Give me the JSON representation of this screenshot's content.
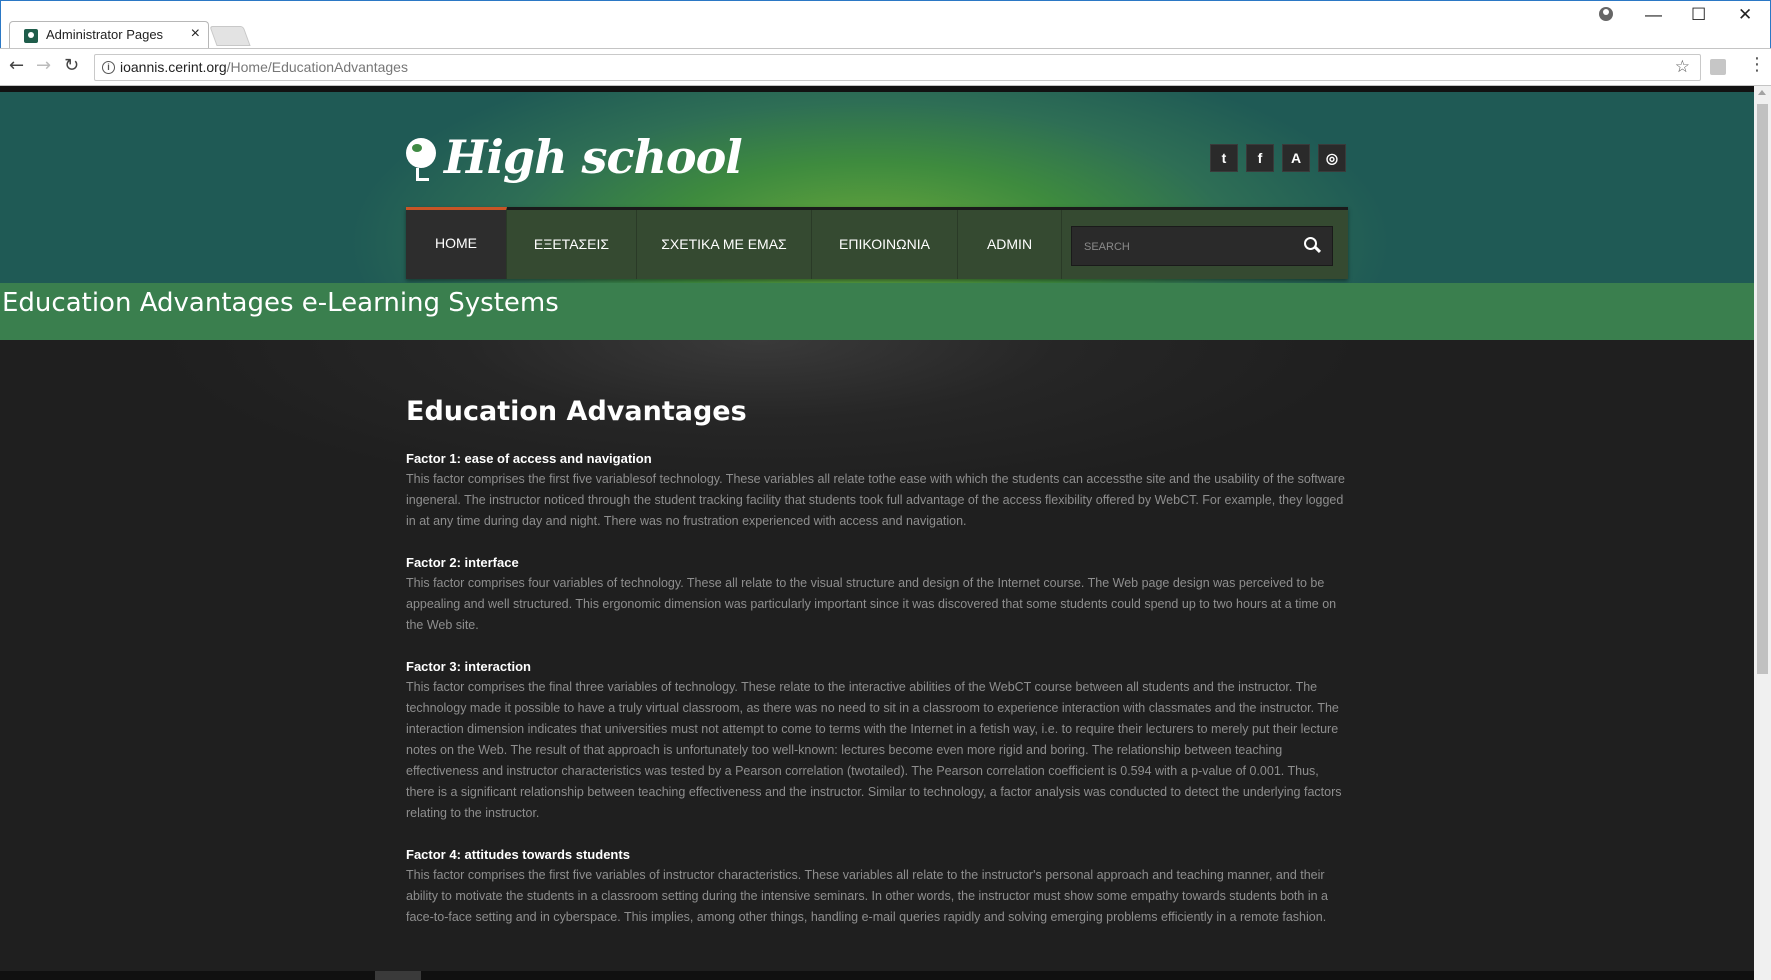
{
  "browser": {
    "tab_title": "Administrator Pages",
    "tab_close": "×",
    "url_host": "ioannis.cerint.org",
    "url_path": "/Home/EducationAdvantages",
    "back": "←",
    "forward": "→",
    "reload": "↻",
    "star": "☆",
    "menu": "⋮",
    "minimize": "—",
    "maximize": "☐",
    "close": "✕"
  },
  "site": {
    "logo_text": "High school",
    "social": [
      {
        "icon": "twitter-icon",
        "glyph": "t"
      },
      {
        "icon": "facebook-icon",
        "glyph": "f"
      },
      {
        "icon": "aim-icon",
        "glyph": "A"
      },
      {
        "icon": "dribbble-icon",
        "glyph": "◎"
      }
    ],
    "nav": [
      {
        "label": "HOME",
        "active": true
      },
      {
        "label": "ΕΞΕΤΑΣΕΙΣ",
        "active": false
      },
      {
        "label": "ΣΧΕΤΙΚΑ ΜΕ ΕΜΑΣ",
        "active": false
      },
      {
        "label": "ΕΠΙΚΟΙΝΩΝΙΑ",
        "active": false
      },
      {
        "label": "ADMIN",
        "active": false
      }
    ],
    "search_placeholder": "SEARCH",
    "colors": {
      "accent": "#c85526",
      "band": "#3a7f4e",
      "nav": "#354a31"
    }
  },
  "page": {
    "band_title": "Education Advantages e-Learning Systems",
    "heading": "Education Advantages",
    "factors": [
      {
        "title": "Factor 1: ease of access and navigation",
        "body": "This factor comprises the first five variablesof technology. These variables all relate tothe ease with which the students can accessthe site and the usability of the software ingeneral. The instructor noticed through the student tracking facility that students took full advantage of the access flexibility offered by WebCT. For example, they logged in at any time during day and night. There was no frustration experienced with access and navigation."
      },
      {
        "title": "Factor 2: interface",
        "body": "This factor comprises four variables of technology. These all relate to the visual structure and design of the Internet course. The Web page design was perceived to be appealing and well structured. This ergonomic dimension was particularly important since it was discovered that some students could spend up to two hours at a time on the Web site."
      },
      {
        "title": "Factor 3: interaction",
        "body": "This factor comprises the final three variables of technology. These relate to the interactive abilities of the WebCT course between all students and the instructor. The technology made it possible to have a truly virtual classroom, as there was no need to sit in a classroom to experience interaction with classmates and the instructor. The interaction dimension indicates that universities must not attempt to come to terms with the Internet in a fetish way, i.e. to require their lecturers to merely put their lecture notes on the Web. The result of that approach is unfortunately too well-known: lectures become even more rigid and boring. The relationship between teaching effectiveness and instructor characteristics was tested by a Pearson correlation (twotailed). The Pearson correlation coefficient is 0.594 with a p-value of 0.001. Thus, there is a significant relationship between teaching effectiveness and the instructor. Similar to technology, a factor analysis was conducted to detect the underlying factors relating to the instructor."
      },
      {
        "title": "Factor 4: attitudes towards students",
        "body": "This factor comprises the first five variables of instructor characteristics. These variables all relate to the instructor's personal approach and teaching manner, and their ability to motivate the students in a classroom setting during the intensive seminars. In other words, the instructor must show some empathy towards students both in a face-to-face setting and in cyberspace. This implies, among other things, handling e-mail queries rapidly and solving emerging problems efficiently in a remote fashion."
      }
    ]
  }
}
